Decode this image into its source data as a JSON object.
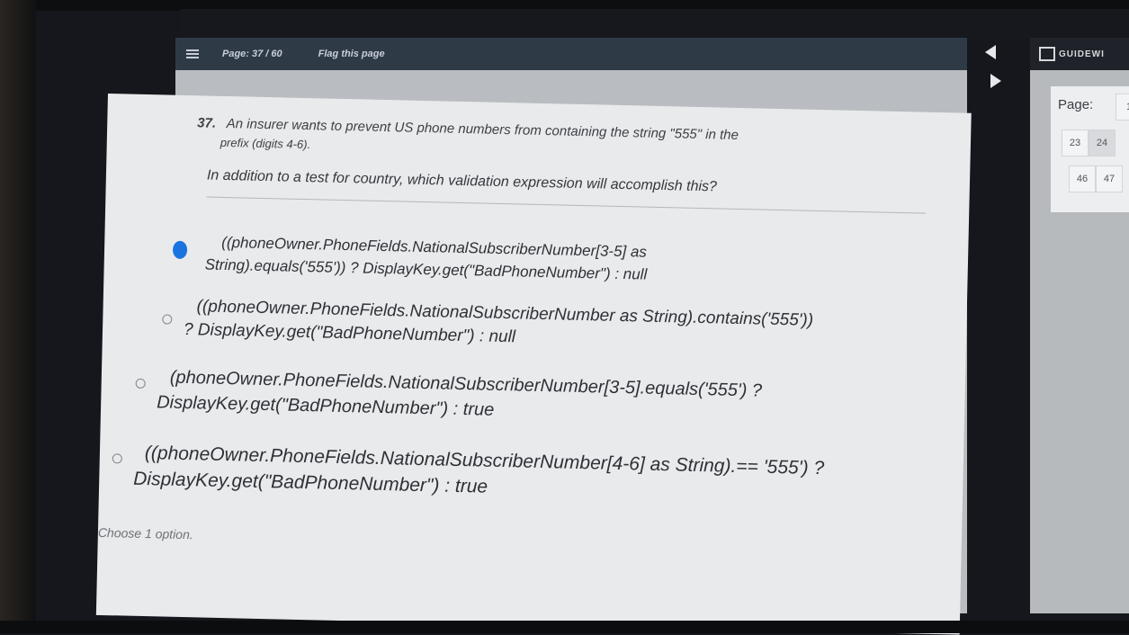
{
  "header": {
    "page_indicator": "Page: 37 / 60",
    "flag_label": "Flag this page"
  },
  "brand": {
    "name": "GUIDEWI"
  },
  "question": {
    "number": "37.",
    "line1": "An insurer wants to prevent US phone numbers from containing the string \"555\" in the",
    "line2": "prefix (digits 4-6).",
    "prompt": "In addition to a test for country, which validation expression will accomplish this?"
  },
  "options": [
    {
      "selected": true,
      "line1": "((phoneOwner.PhoneFields.NationalSubscriberNumber[3-5] as",
      "line2": "String).equals('555')) ? DisplayKey.get(\"BadPhoneNumber\") : null"
    },
    {
      "selected": false,
      "line1": "((phoneOwner.PhoneFields.NationalSubscriberNumber as String).contains('555'))",
      "line2": "? DisplayKey.get(\"BadPhoneNumber\") : null"
    },
    {
      "selected": false,
      "line1": "(phoneOwner.PhoneFields.NationalSubscriberNumber[3-5].equals('555') ?",
      "line2": "DisplayKey.get(\"BadPhoneNumber\") : true"
    },
    {
      "selected": false,
      "line1": "((phoneOwner.PhoneFields.NationalSubscriberNumber[4-6] as String).== '555') ?",
      "line2": "DisplayKey.get(\"BadPhoneNumber\") : true"
    }
  ],
  "hint": "Choose 1 option.",
  "page_navigator": {
    "label": "Page:",
    "cells": [
      "1",
      "23",
      "24",
      "46",
      "47"
    ],
    "current": "24"
  },
  "colors": {
    "accent": "#1a74e0",
    "topbar": "#2f3a47"
  },
  "icons": [
    "menu-icon",
    "collapse-panel-icon",
    "expand-panel-icon",
    "guidewire-logo"
  ]
}
